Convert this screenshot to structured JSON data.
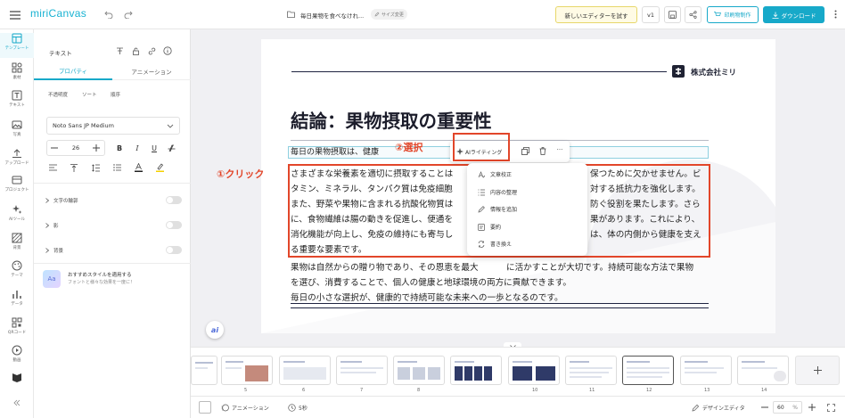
{
  "app": {
    "logo": "miriCanvas",
    "doc_title": "毎日果物を食べなけれ...",
    "size_change": "サイズ変更",
    "try_editor": "新しいエディターを試す",
    "version": "v1",
    "print_button": "印刷物制作",
    "download_button": "ダウンロード",
    "accent": "#17a9c9"
  },
  "rail": [
    {
      "label": "テンプレート",
      "icon": "template-icon"
    },
    {
      "label": "素材",
      "icon": "elements-icon"
    },
    {
      "label": "テキスト",
      "icon": "text-icon"
    },
    {
      "label": "写真",
      "icon": "photo-icon"
    },
    {
      "label": "アップロード",
      "icon": "upload-icon"
    },
    {
      "label": "プロジェクト",
      "icon": "project-icon"
    },
    {
      "label": "AIツール",
      "icon": "ai-tools-icon"
    },
    {
      "label": "背景",
      "icon": "background-icon"
    },
    {
      "label": "テーマ",
      "icon": "theme-icon"
    },
    {
      "label": "データ",
      "icon": "data-icon"
    },
    {
      "label": "QRコード",
      "icon": "qr-icon"
    },
    {
      "label": "動画",
      "icon": "video-icon"
    }
  ],
  "panel": {
    "title": "テキスト",
    "tabs": [
      "プロパティ",
      "アニメーション"
    ],
    "subtabs": [
      "不透明度",
      "ソート",
      "順序"
    ],
    "font": "Noto Sans JP Medium",
    "font_size": "26",
    "styles": [
      "B",
      "I",
      "U"
    ],
    "effects": [
      "文字の輪郭",
      "影",
      "背景"
    ],
    "suggest_title": "おすすめスタイルを適用する",
    "suggest_sub": "フォントと様々な効果を一度に！",
    "suggest_badge": "Aa"
  },
  "slide": {
    "company": "株式会社ミリ",
    "heading": "結論：果物摂取の重要性",
    "intro": "毎日の果物摂取は、健康",
    "para1": [
      "さまざまな栄養素を適切に摂取することは",
      "タミン、ミネラル、タンパク質は免疫細胞",
      "また、野菜や果物に含まれる抗酸化物質は",
      "に、食物繊維は腸の動きを促進し、便通を",
      "消化機能が向上し、免疫の維持にも寄与し",
      "る重要な要素です。"
    ],
    "para1_right": [
      "保つために欠かせません。ビ",
      "対する抵抗力を強化します。",
      "防ぐ役割を果たします。さら",
      "果があります。これにより、",
      "は、体の内側から健康を支え"
    ],
    "para2": [
      "果物は自然からの贈り物であり、その恩恵を最大",
      "に活かすことが大切です。持続可能な方法で果物",
      "を選び、消費することで、個人の健康と地球環境の両方に貢献できます。",
      "毎日の小さな選択が、健康的で持続可能な未来への一歩となるのです。"
    ]
  },
  "annotations": {
    "click": "①クリック",
    "select": "②選択"
  },
  "toolbar": {
    "ai_writing": "AIライティング",
    "more": "···"
  },
  "ai_menu": [
    "文章校正",
    "内容の整理",
    "情報を追加",
    "要約",
    "書き換え"
  ],
  "ai_badge": "ai",
  "thumbnails": [
    "5",
    "6",
    "7",
    "8",
    "9",
    "10",
    "11",
    "12",
    "13",
    "14"
  ],
  "bottombar": {
    "animation": "アニメーション",
    "duration": "5秒",
    "design_editor": "デザインエディタ",
    "zoom": "60",
    "zoom_unit": "%"
  }
}
